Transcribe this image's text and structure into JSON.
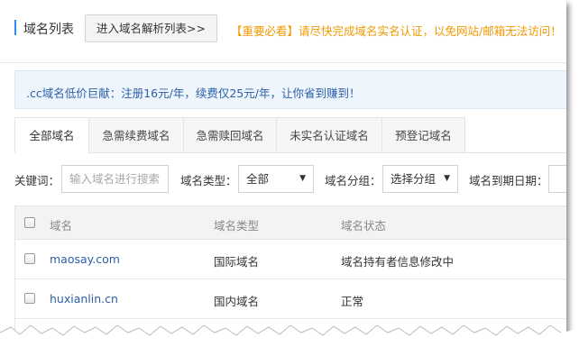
{
  "header": {
    "title": "域名列表",
    "enter_button": "进入域名解析列表>>",
    "notice": "【重要必看】请尽快完成域名实名认证，以免网站/邮箱无法访问！"
  },
  "promo": {
    "text": ".cc域名低价巨献：注册16元/年，续费仅25元/年，让你省到赚到！"
  },
  "tabs": [
    {
      "label": "全部域名",
      "active": true
    },
    {
      "label": "急需续费域名",
      "active": false
    },
    {
      "label": "急需赎回域名",
      "active": false
    },
    {
      "label": "未实名认证域名",
      "active": false
    },
    {
      "label": "预登记域名",
      "active": false
    }
  ],
  "filters": {
    "keyword_label": "关键词：",
    "keyword_placeholder": "输入域名进行搜索",
    "type_label": "域名类型：",
    "type_value": "全部",
    "group_label": "域名分组：",
    "group_value": "选择分组",
    "expiry_label": "域名到期日期："
  },
  "table": {
    "columns": [
      "域名",
      "域名类型",
      "域名状态"
    ],
    "rows": [
      {
        "domain": "maosay.com",
        "type": "国际域名",
        "status": "域名持有者信息修改中"
      },
      {
        "domain": "huxianlin.cn",
        "type": "国内域名",
        "status": "正常"
      }
    ]
  },
  "colors": {
    "accent": "#2d8cf0",
    "notice": "#f39800",
    "link": "#2a5fa8",
    "promo_bg": "#eef5fc"
  }
}
